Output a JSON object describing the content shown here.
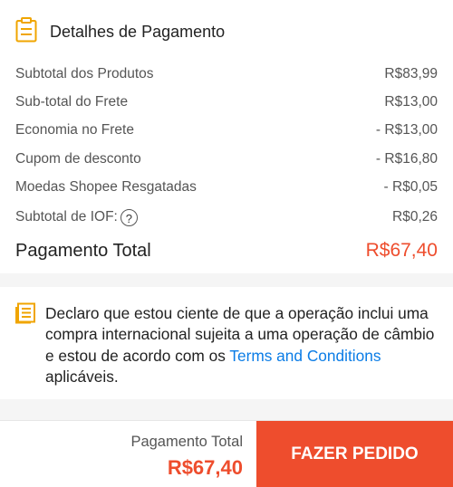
{
  "payment": {
    "title": "Detalhes de Pagamento",
    "rows": [
      {
        "label": "Subtotal dos Produtos",
        "value": "R$83,99"
      },
      {
        "label": "Sub-total do Frete",
        "value": "R$13,00"
      },
      {
        "label": "Economia no Frete",
        "value": "- R$13,00"
      },
      {
        "label": "Cupom de desconto",
        "value": "- R$16,80"
      },
      {
        "label": "Moedas Shopee Resgatadas",
        "value": "- R$0,05"
      },
      {
        "label": "Subtotal de IOF:",
        "value": "R$0,26"
      }
    ],
    "help_glyph": "?",
    "total_label": "Pagamento Total",
    "total_value": "R$67,40"
  },
  "declaration": {
    "text_before": "Declaro que estou ciente de que a operação inclui uma compra internacional sujeita a uma operação de câmbio e estou de acordo com os ",
    "link_text": "Terms and Conditions",
    "text_after": " aplicáveis."
  },
  "footer": {
    "total_label": "Pagamento Total",
    "total_value": "R$67,40",
    "order_button": "FAZER PEDIDO"
  },
  "colors": {
    "accent": "#ee4d2d",
    "link": "#0a7ce6",
    "icon": "#f0a500"
  },
  "icons": {
    "header": "clipboard-icon",
    "declaration": "document-icon",
    "help": "question-circle-icon"
  }
}
